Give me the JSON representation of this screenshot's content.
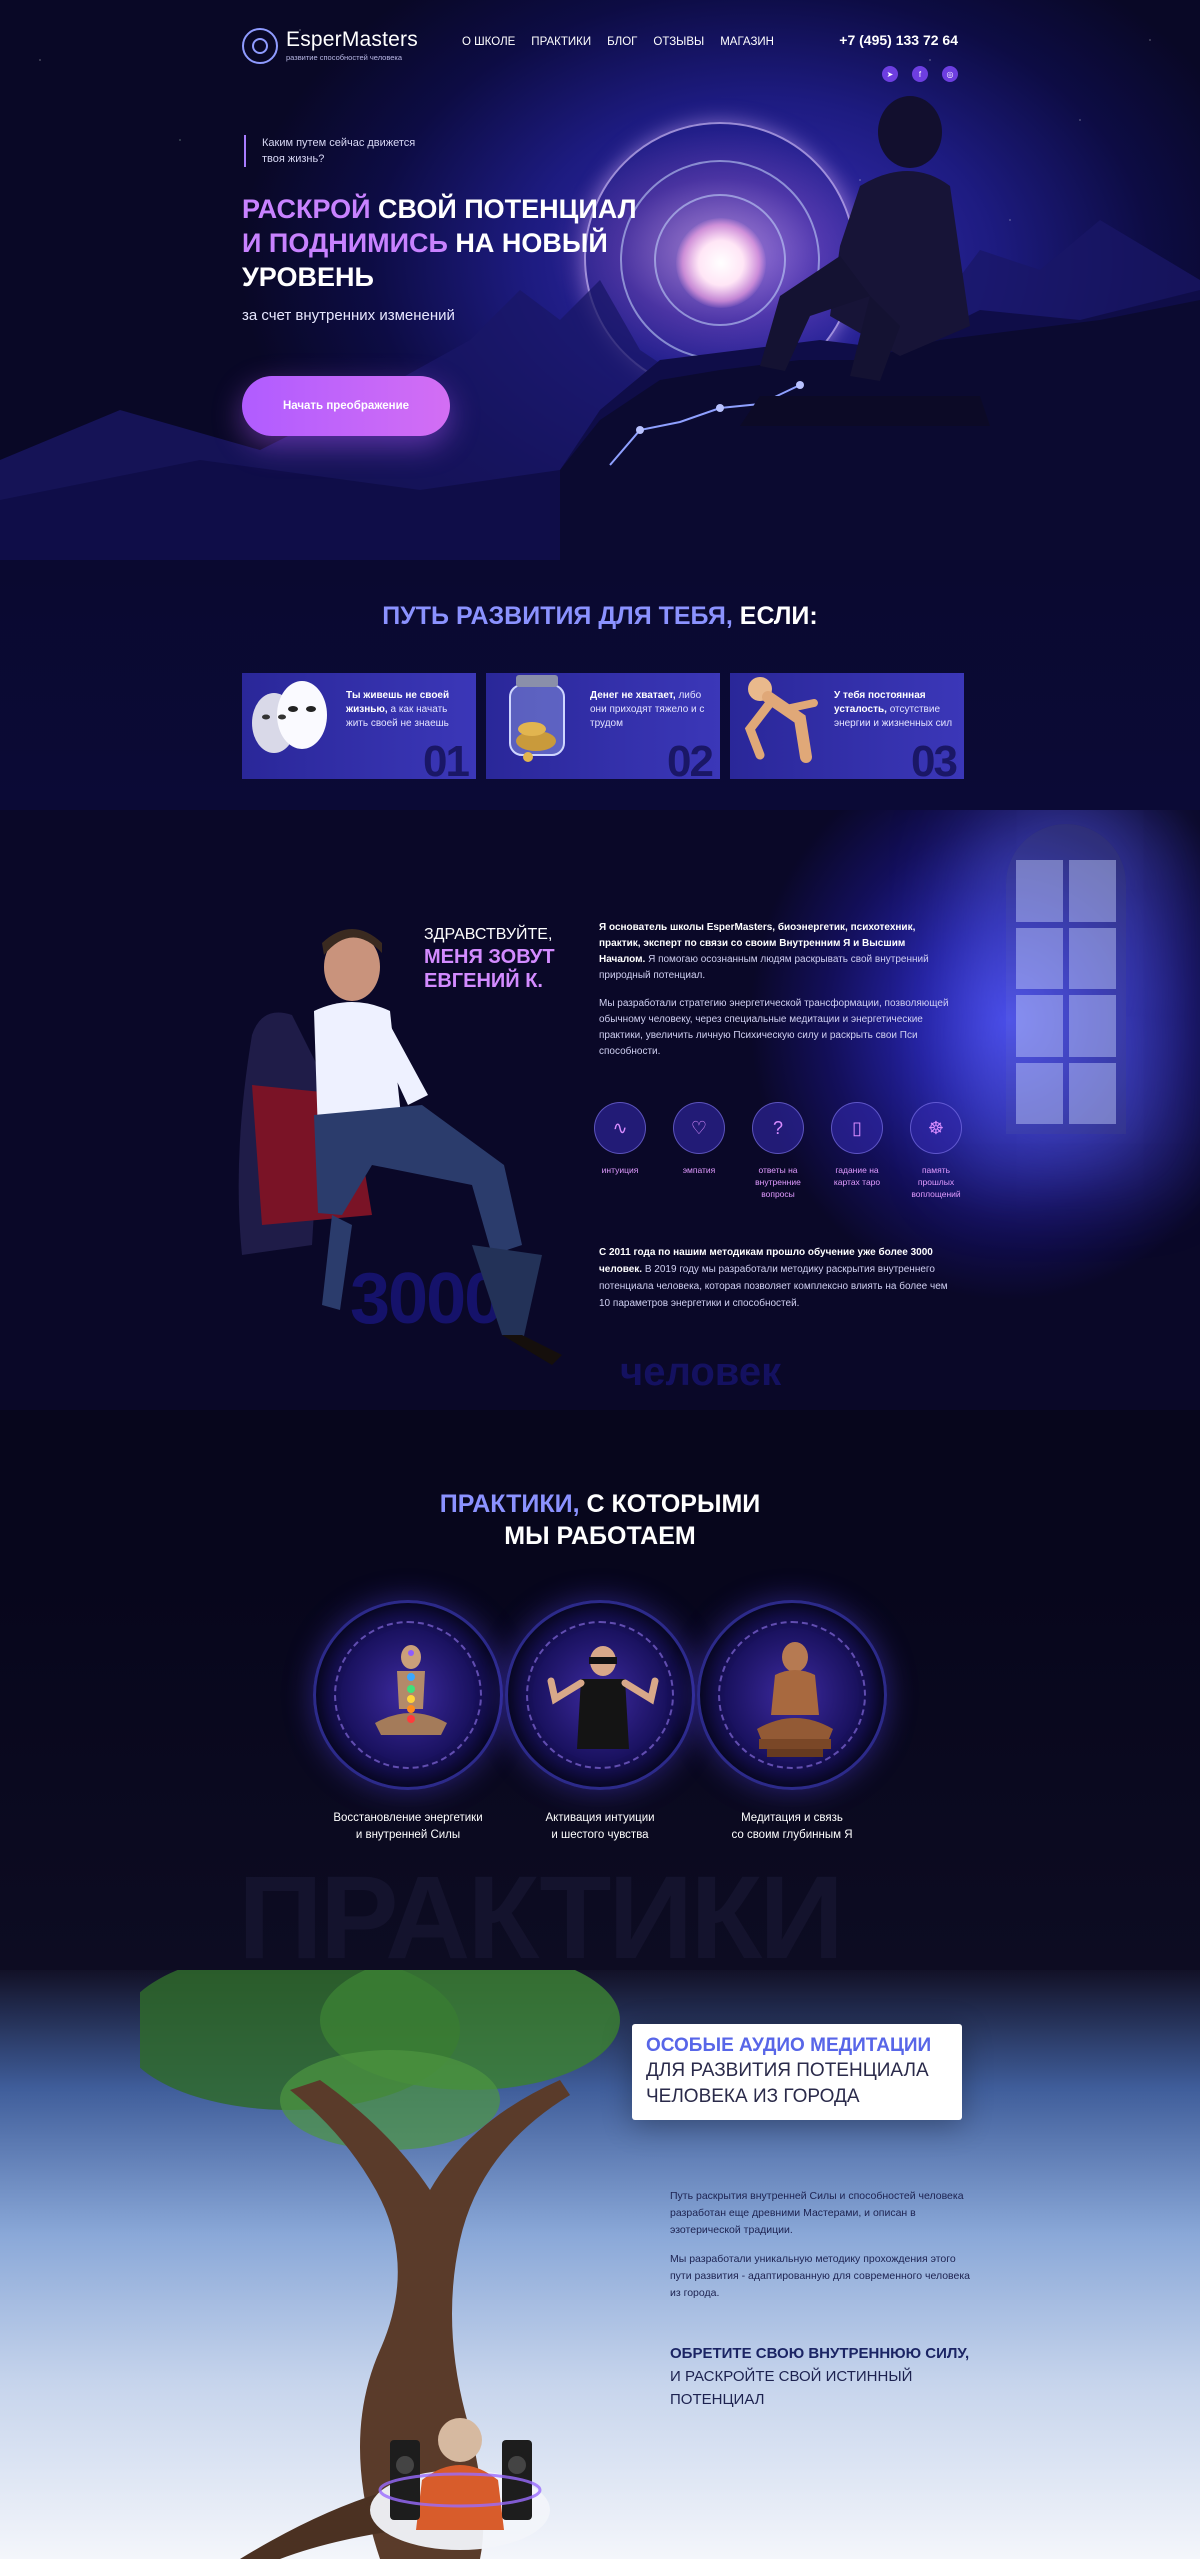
{
  "brand": {
    "name": "EsperMasters",
    "tagline": "развитие способностей человека"
  },
  "nav": [
    "О ШКОЛЕ",
    "ПРАКТИКИ",
    "БЛОГ",
    "ОТЗЫВЫ",
    "МАГАЗИН"
  ],
  "contacts": {
    "phone": "+7 (495) 133 72 64"
  },
  "socials": [
    "telegram-icon",
    "facebook-icon",
    "instagram-icon"
  ],
  "hero": {
    "question": "Каким путем сейчас движется твоя жизнь?",
    "title_accent_1": "РАСКРОЙ",
    "title_plain_1": "СВОЙ ПОТЕНЦИАЛ",
    "title_accent_2": "И ПОДНИМИСЬ",
    "title_plain_2": "НА НОВЫЙ УРОВЕНЬ",
    "subtitle": "за счет внутренних изменений",
    "cta": "Начать преображение"
  },
  "path": {
    "title_accent": "ПУТЬ РАЗВИТИЯ ДЛЯ ТЕБЯ,",
    "title_plain": "ЕСЛИ:",
    "cards": [
      {
        "bold": "Ты живешь не своей жизнью,",
        "text": "а как начать жить своей не знаешь",
        "num": "01"
      },
      {
        "bold": "Денег не хватает,",
        "text": "либо они приходят тяжело и с трудом",
        "num": "02"
      },
      {
        "bold": "У тебя постоянная усталость,",
        "text": "отсутствие энергии и жизненных сил",
        "num": "03"
      }
    ]
  },
  "founder": {
    "hello": "ЗДРАВСТВУЙТЕ,",
    "name_line1": "МЕНЯ ЗОВУТ",
    "name_line2": "ЕВГЕНИЙ К.",
    "bio_bold": "Я основатель школы EsperMasters, биоэнергетик, психотехник, практик, эксперт по связи со своим Внутренним Я и Высшим Началом.",
    "bio_rest": "Я помогаю осознанным людям раскрывать свой внутренний природный потенциал.",
    "bio_2": "Мы разработали стратегию энергетической трансформации, позволяющей обычному человеку, через специальные медитации и энергетические практики, увеличить личную Психическую силу и раскрыть свои Пси способности.",
    "skills": [
      {
        "icon": "intuition-icon",
        "glyph": "∿",
        "label": "интуиция"
      },
      {
        "icon": "empathy-icon",
        "glyph": "♡",
        "label": "эмпатия"
      },
      {
        "icon": "question-icon",
        "glyph": "?",
        "label": "ответы на внутренние вопросы"
      },
      {
        "icon": "tarot-icon",
        "glyph": "▯",
        "label": "гадание на картах таро"
      },
      {
        "icon": "past-lives-icon",
        "glyph": "☸",
        "label": "память прошлых воплощений"
      }
    ],
    "stats_bold": "С 2011 года по нашим методикам прошло обучение уже более 3000 человек.",
    "stats_rest": "В 2019 году мы разработали методику раскрытия внутреннего потенциала человека, которая позволяет комплексно влиять на более чем 10 параметров энергетики и способностей.",
    "ghost_num": "3000",
    "ghost_word": "человек"
  },
  "practices": {
    "title_accent": "ПРАКТИКИ,",
    "title_plain_1": "С КОТОРЫМИ",
    "title_plain_2": "МЫ РАБОТАЕМ",
    "items": [
      {
        "line1": "Восстановление энергетики",
        "line2": "и внутренней Силы"
      },
      {
        "line1": "Активация интуиции",
        "line2": "и шестого чувства"
      },
      {
        "line1": "Медитация и связь",
        "line2": "со своим глубинным Я"
      }
    ],
    "ghost": "ПРАКТИКИ"
  },
  "audio": {
    "banner_accent": "ОСОБЫЕ АУДИО МЕДИТАЦИИ",
    "banner_line2": "ДЛЯ РАЗВИТИЯ ПОТЕНЦИАЛА",
    "banner_line3": "ЧЕЛОВЕКА ИЗ ГОРОДА",
    "p1": "Путь раскрытия внутренней Силы и способностей человека разработан еще древними Мастерами, и описан в эзотерической традиции.",
    "p2": "Мы разработали уникальную методику прохождения этого пути развития - адаптированную для современного человека из города.",
    "cta_bold": "ОБРЕТИТЕ СВОЮ ВНУТРЕННЮЮ СИЛУ,",
    "cta_plain": "И РАСКРОЙТЕ СВОЙ ИСТИННЫЙ ПОТЕНЦИАЛ"
  }
}
